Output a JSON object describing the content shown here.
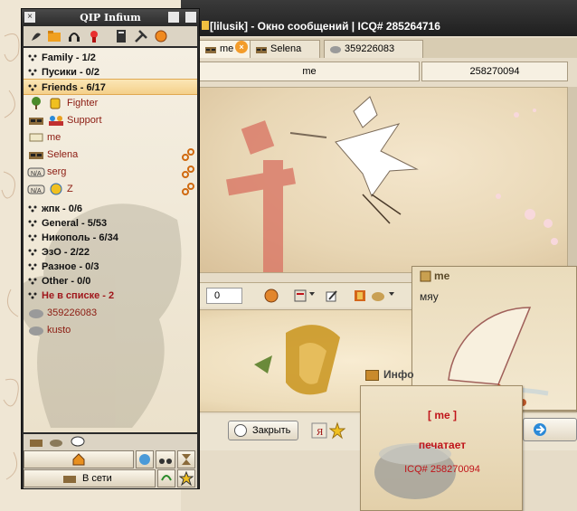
{
  "chat": {
    "title": "[lilusik] - Окно сообщений | ICQ# 285264716",
    "tabs": [
      {
        "label": "me"
      },
      {
        "label": "Selena"
      },
      {
        "label": "359226083"
      }
    ],
    "fields": {
      "nick": "me",
      "uin": "258270094"
    },
    "toolbar_counter": "0",
    "close_label": "Закрыть"
  },
  "popup_message": {
    "sender": "me",
    "text": "мяу"
  },
  "popup_info": {
    "header": "Инфо",
    "name": "[ me ]",
    "status": "печатает",
    "icq": "ICQ# 258270094"
  },
  "qip": {
    "title": "QIP Infium",
    "groups": [
      {
        "label": "Family - 1/2"
      },
      {
        "label": "Пусики - 0/2"
      },
      {
        "label": "Friends - 6/17"
      },
      {
        "label": "жпк - 0/6"
      },
      {
        "label": "General - 5/53"
      },
      {
        "label": "Никополь - 6/34"
      },
      {
        "label": "ЭзО - 2/22"
      },
      {
        "label": "Разное - 0/3"
      },
      {
        "label": "Other - 0/0"
      },
      {
        "label": "Не в списке - 2"
      }
    ],
    "contacts": [
      {
        "label": "Fighter"
      },
      {
        "label": "Support"
      },
      {
        "label": "me"
      },
      {
        "label": "Selena"
      },
      {
        "label": "serg"
      },
      {
        "label": "Z"
      },
      {
        "label": "359226083"
      },
      {
        "label": "kusto"
      }
    ],
    "status_label": "В сети"
  },
  "colors": {
    "accent_red": "#c0141a",
    "contact_red": "#8b1a10",
    "highlight": "#f4d08a",
    "titlebar": "#2c2c2c"
  }
}
